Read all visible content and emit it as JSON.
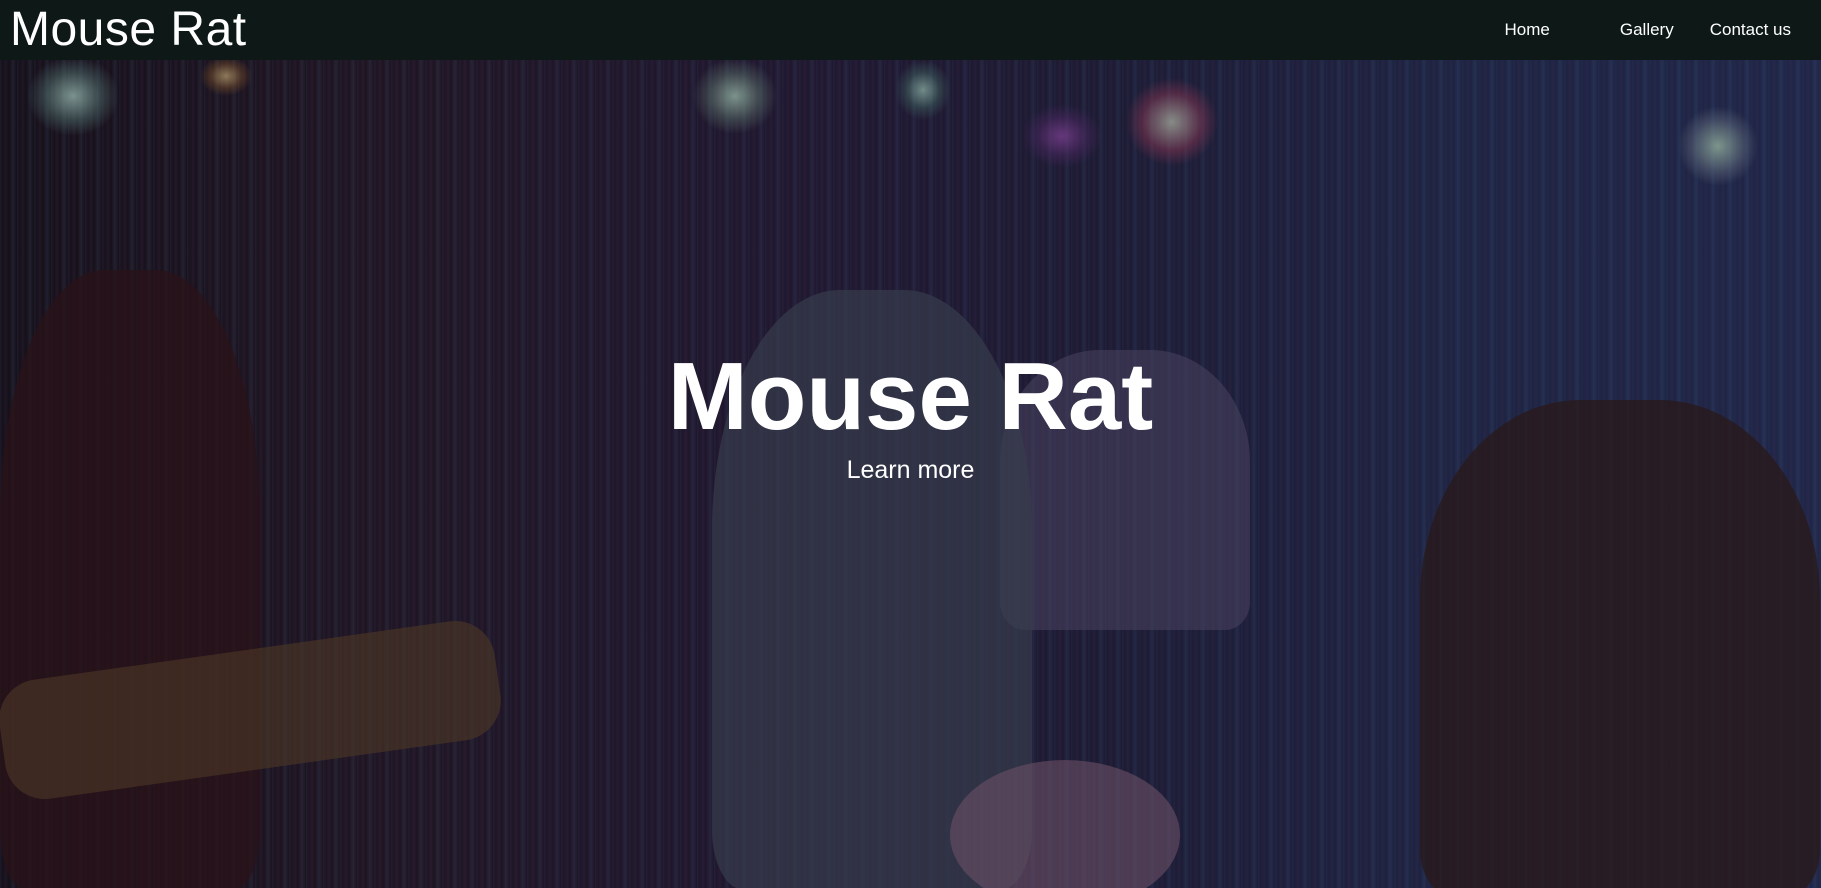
{
  "header": {
    "brand": "Mouse Rat",
    "nav": [
      {
        "label": "Home"
      },
      {
        "label": "Gallery"
      },
      {
        "label": "Contact us"
      }
    ]
  },
  "hero": {
    "background_image": "band-performing-on-stage-photo",
    "title": "Mouse Rat",
    "cta_label": "Learn more"
  }
}
